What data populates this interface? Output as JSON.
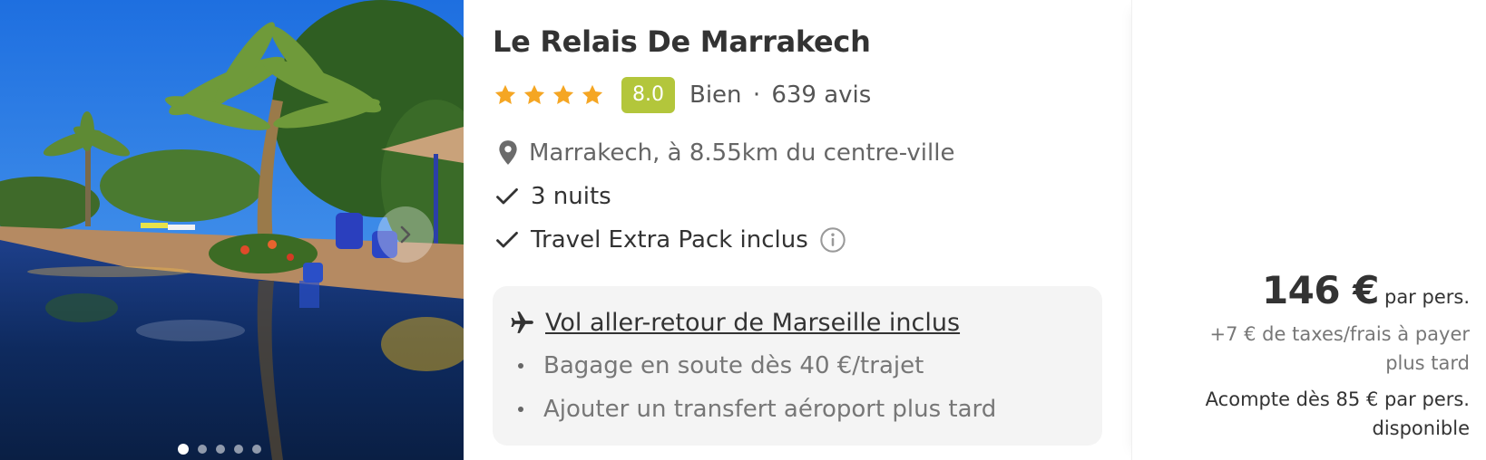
{
  "hotel": {
    "name": "Le Relais De Marrakech",
    "stars": 4,
    "score": "8.0",
    "rating_label": "Bien",
    "separator": "·",
    "reviews": "639 avis",
    "location": "Marrakech, à 8.55km du centre-ville"
  },
  "features": [
    {
      "label": "3 nuits",
      "icon": "check-icon"
    },
    {
      "label": "Travel Extra Pack inclus",
      "icon": "check-icon",
      "info": "info-icon"
    }
  ],
  "flight": {
    "label": "Vol aller-retour de Marseille inclus",
    "icon": "plane-icon",
    "extras": [
      "Bagage en soute dès 40 €/trajet",
      "Ajouter un transfert aéroport plus tard"
    ]
  },
  "price": {
    "amount": "146 €",
    "unit": "par pers.",
    "taxes": "+7 € de taxes/frais à payer plus tard",
    "deposit": "Acompte dès 85 € par pers. disponible"
  },
  "gallery": {
    "image_count": 5,
    "active_index": 0,
    "next_icon": "chevron-right-icon"
  },
  "colors": {
    "score_bg": "#b3c63b",
    "star": "#f5a623",
    "text": "#333333",
    "muted": "#777777",
    "flight_box": "#f4f4f4"
  }
}
